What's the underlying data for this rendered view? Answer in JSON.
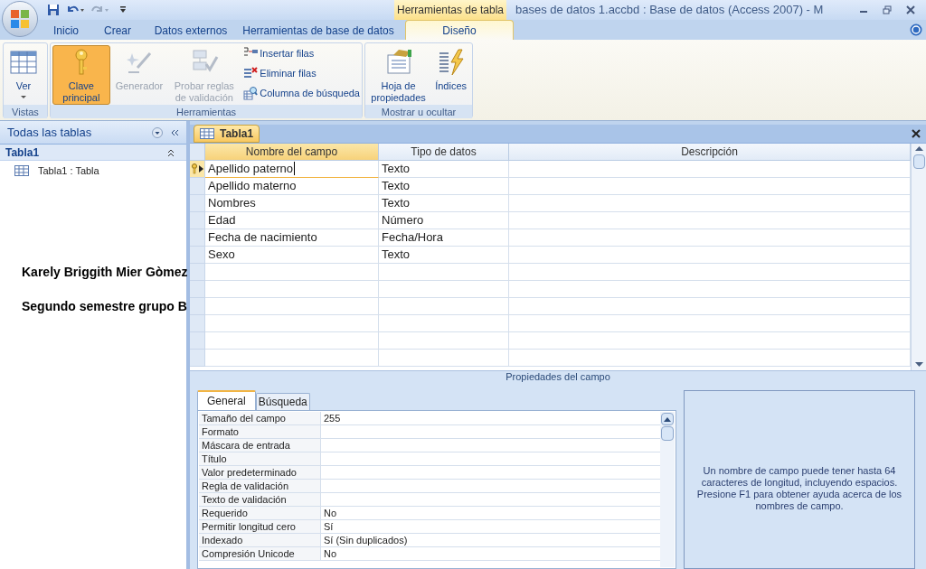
{
  "window": {
    "title": "bases de datos 1.accbd : Base de datos (Access 2007) - M",
    "context_group": "Herramientas de tabla"
  },
  "ribbon_tabs": [
    {
      "label": "Inicio",
      "selected": false
    },
    {
      "label": "Crear",
      "selected": false
    },
    {
      "label": "Datos externos",
      "selected": false
    },
    {
      "label": "Herramientas de base de datos",
      "selected": false
    },
    {
      "label": "Diseño",
      "selected": true
    }
  ],
  "ribbon_groups": [
    {
      "label": "Vistas",
      "buttons": [
        {
          "kind": "large",
          "label": "Ver",
          "disabled": false,
          "on": false
        }
      ]
    },
    {
      "label": "Herramientas",
      "buttons": [
        {
          "kind": "large",
          "label": "Clave principal",
          "disabled": false,
          "on": true
        },
        {
          "kind": "large",
          "label": "Generador",
          "disabled": true,
          "on": false
        },
        {
          "kind": "large",
          "label": "Probar reglas de validación",
          "disabled": true,
          "on": false
        },
        {
          "kind": "small",
          "label": "Insertar filas",
          "disabled": false
        },
        {
          "kind": "small",
          "label": "Eliminar filas",
          "disabled": false
        },
        {
          "kind": "small",
          "label": "Columna de búsqueda",
          "disabled": false
        }
      ]
    },
    {
      "label": "Mostrar u ocultar",
      "buttons": [
        {
          "kind": "large",
          "label": "Hoja de propiedades",
          "disabled": false,
          "on": false
        },
        {
          "kind": "large",
          "label": "Índices",
          "disabled": false,
          "on": false
        }
      ]
    }
  ],
  "nav_pane": {
    "header": "Todas las tablas",
    "group": "Tabla1",
    "items": [
      "Tabla1 : Tabla"
    ]
  },
  "overlay_text": [
    "Karely Briggith Mier Gòmez",
    "Segundo semestre grupo B"
  ],
  "document_tab": "Tabla1",
  "design_grid": {
    "columns": [
      "Nombre del campo",
      "Tipo de datos",
      "Descripción"
    ],
    "rows": [
      {
        "name": "Apellido paterno",
        "type": "Texto",
        "primary_key": true,
        "current": true
      },
      {
        "name": "Apellido materno",
        "type": "Texto",
        "primary_key": false,
        "current": false
      },
      {
        "name": "Nombres",
        "type": "Texto",
        "primary_key": false,
        "current": false
      },
      {
        "name": "Edad",
        "type": "Número",
        "primary_key": false,
        "current": false
      },
      {
        "name": "Fecha de nacimiento",
        "type": "Fecha/Hora",
        "primary_key": false,
        "current": false
      },
      {
        "name": "Sexo",
        "type": "Texto",
        "primary_key": false,
        "current": false
      }
    ]
  },
  "field_properties": {
    "title": "Propiedades del campo",
    "tabs": [
      {
        "label": "General",
        "selected": true
      },
      {
        "label": "Búsqueda",
        "selected": false
      }
    ],
    "rows": [
      {
        "label": "Tamaño del campo",
        "value": "255"
      },
      {
        "label": "Formato"
      },
      {
        "label": "Máscara de entrada"
      },
      {
        "label": "Título"
      },
      {
        "label": "Valor predeterminado"
      },
      {
        "label": "Regla de validación"
      },
      {
        "label": "Texto de validación"
      },
      {
        "label": "Requerido",
        "value": "No"
      },
      {
        "label": "Permitir longitud cero",
        "value": "Sí"
      },
      {
        "label": "Indexado",
        "value": "Sí (Sin duplicados)"
      },
      {
        "label": "Compresión Unicode",
        "value": "No"
      }
    ],
    "help": "Un nombre de campo puede tener hasta 64 caracteres de longitud, incluyendo espacios. Presione F1 para obtener ayuda acerca de los nombres de campo."
  }
}
